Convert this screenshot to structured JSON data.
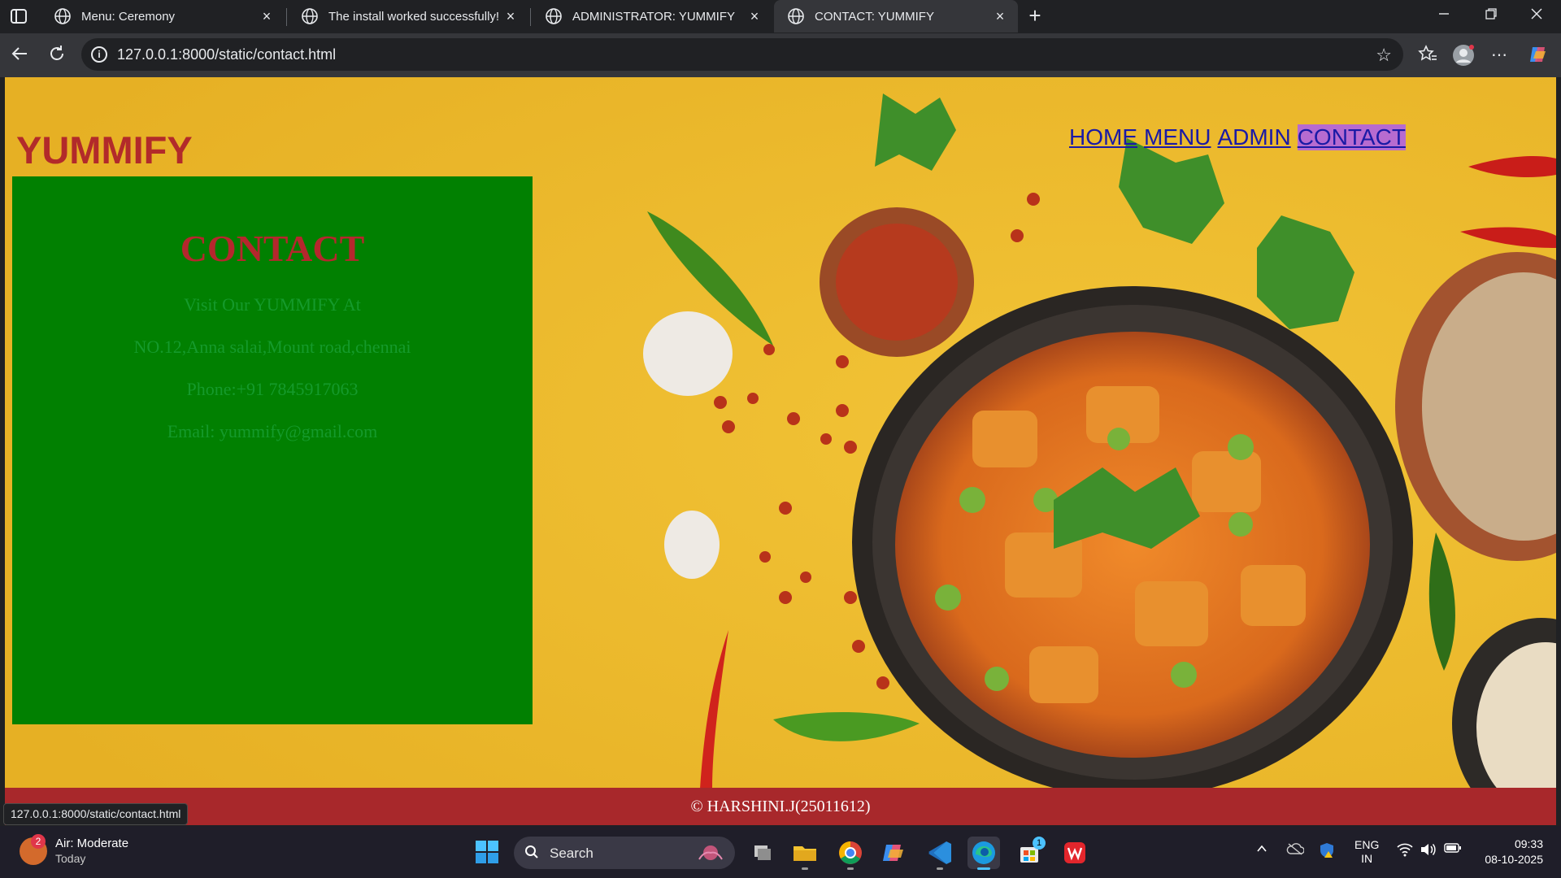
{
  "browser": {
    "tabs": [
      {
        "title": "Menu: Ceremony",
        "close": "×"
      },
      {
        "title": "The install worked successfully! C",
        "close": "×"
      },
      {
        "title": "ADMINISTRATOR: YUMMIFY",
        "close": "×"
      },
      {
        "title": "CONTACT: YUMMIFY",
        "close": "×",
        "active": true
      }
    ],
    "new_tab": "+",
    "url": "127.0.0.1:8000/static/contact.html",
    "status_url": "127.0.0.1:8000/static/contact.html"
  },
  "page": {
    "brand": "YUMMIFY",
    "nav": [
      {
        "label": "HOME"
      },
      {
        "label": "MENU"
      },
      {
        "label": "ADMIN"
      },
      {
        "label": "CONTACT",
        "current": true
      }
    ],
    "contact": {
      "heading": "CONTACT",
      "lines": [
        "Visit Our YUMMIFY At",
        "NO.12,Anna salai,Mount road,chennai",
        "Phone:+91 7845917063",
        "Email: yummify@gmail.com"
      ]
    },
    "footer": "© HARSHINI.J(25011612)"
  },
  "taskbar": {
    "weather": {
      "title": "Air: Moderate",
      "sub": "Today",
      "badge": "2"
    },
    "search_label": "Search",
    "store_badge": "1",
    "lang": {
      "line1": "ENG",
      "line2": "IN"
    },
    "time": "09:33",
    "date": "08-10-2025"
  },
  "colors": {
    "brand_red": "#b22a2a",
    "card_green": "#018001",
    "footer_red": "#a8282b",
    "nav_blue": "#1a1aa6",
    "nav_highlight": "#b76bd0"
  }
}
